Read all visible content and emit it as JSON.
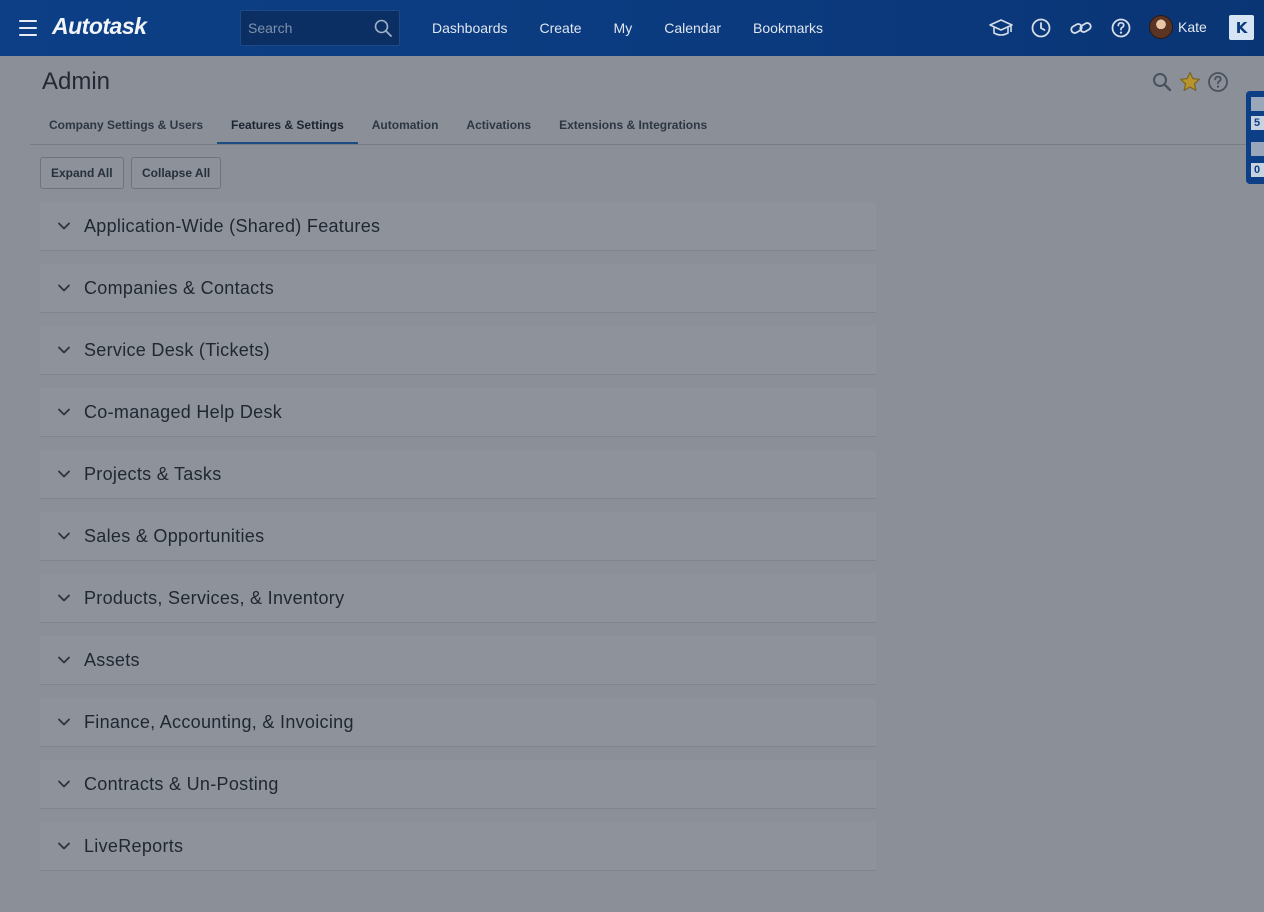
{
  "header": {
    "logo": "Autotask",
    "search_placeholder": "Search",
    "nav": [
      "Dashboards",
      "Create",
      "My",
      "Calendar",
      "Bookmarks"
    ],
    "icons": [
      "graduation-cap-icon",
      "clock-icon",
      "link-icon",
      "help-icon"
    ],
    "user_name": "Kate",
    "badge": "K"
  },
  "page": {
    "title": "Admin",
    "title_icons": [
      "search-icon",
      "star-icon",
      "help-icon"
    ]
  },
  "tabs": [
    {
      "label": "Company Settings & Users",
      "active": false
    },
    {
      "label": "Features & Settings",
      "active": true
    },
    {
      "label": "Automation",
      "active": false
    },
    {
      "label": "Activations",
      "active": false
    },
    {
      "label": "Extensions & Integrations",
      "active": false
    }
  ],
  "toolbar": {
    "expand_label": "Expand All",
    "collapse_label": "Collapse All"
  },
  "sections": [
    "Application-Wide (Shared) Features",
    "Companies & Contacts",
    "Service Desk (Tickets)",
    "Co-managed Help Desk",
    "Projects & Tasks",
    "Sales & Opportunities",
    "Products, Services, & Inventory",
    "Assets",
    "Finance, Accounting, & Invoicing",
    "Contracts & Un-Posting",
    "LiveReports"
  ],
  "side_widget": {
    "count_1": "5",
    "count_2": "0"
  },
  "colors": {
    "header_bg": "#0b3a7e",
    "overlay_bg": "#8a8f98",
    "tab_underline": "#1c4a82",
    "star": "#b8942e"
  }
}
